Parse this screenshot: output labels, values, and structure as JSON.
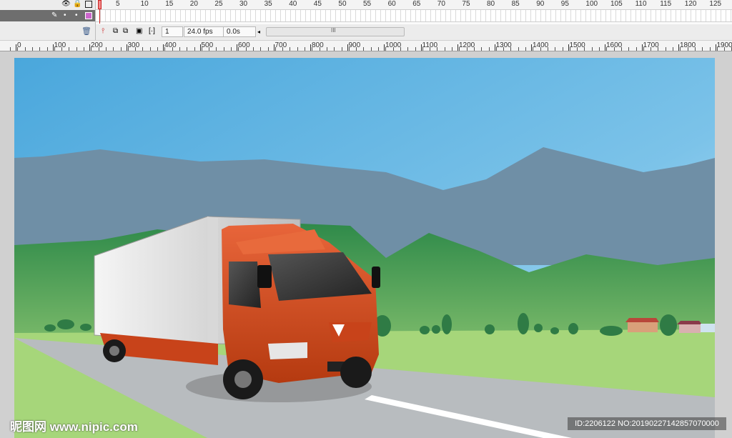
{
  "timeline": {
    "frame_numbers": [
      "5",
      "10",
      "15",
      "20",
      "25",
      "30",
      "35",
      "40",
      "45",
      "50",
      "55",
      "60",
      "65",
      "70",
      "75",
      "80",
      "85",
      "90",
      "95",
      "100",
      "105",
      "110",
      "115",
      "120",
      "125"
    ],
    "current_frame": "1",
    "fps": "24.0 fps",
    "time": "0.0s",
    "scroll_grip": "III"
  },
  "ruler": {
    "labels": [
      "0",
      "100",
      "200",
      "300",
      "400",
      "500",
      "600",
      "700",
      "800",
      "900",
      "1000",
      "1100",
      "1200",
      "1300",
      "1400",
      "1500",
      "1600",
      "1700",
      "1800",
      "1900"
    ]
  },
  "icons": {
    "eye": "eye-icon",
    "lock": "lock-icon",
    "outline": "outline-icon",
    "pencil": "pencil-icon",
    "trash": "trash-icon"
  },
  "colors": {
    "layer_color": "#cc66cc",
    "sky_top": "#52aee0",
    "truck_cab": "#d9501e",
    "road": "#b8bcbf"
  },
  "watermark": {
    "left": "昵图网 www.nipic.com",
    "right": "ID:2206122 NO:20190227142857070000"
  }
}
